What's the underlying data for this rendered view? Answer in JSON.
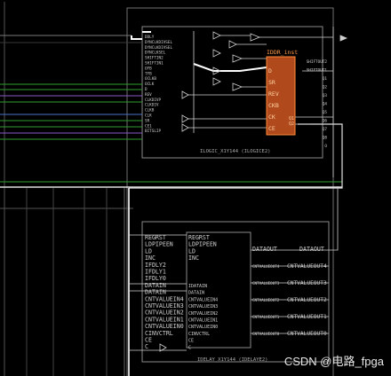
{
  "ilogic": {
    "title": "ILOGIC_X1Y144 (ILOGICE2)",
    "ports": [
      "DDLY",
      "DYNCLKDIVSEL",
      "DYNCLKDIVSEL",
      "DYNCLKSEL",
      "SHIFTIN2",
      "SHIFTIN1",
      "OFB",
      "TFB",
      "OCLKB",
      "OCLK",
      "D",
      "REV",
      "CLKDIVP",
      "CLKDIV",
      "CLKB",
      "CLK",
      "SR",
      "CE1",
      "BITSLIP"
    ],
    "right_ports": [
      "SHIFTOUT2",
      "SHIFTOUT1",
      "Q1",
      "Q2",
      "Q3",
      "Q4",
      "Q5",
      "Q6",
      "Q7",
      "Q8",
      "O"
    ]
  },
  "iddr": {
    "title": "IDDR_inst",
    "pins_left": [
      "D",
      "SR",
      "REV",
      "CKB",
      "CK",
      "CE"
    ],
    "pins_right": [
      "Q1",
      "Q2"
    ]
  },
  "idelay": {
    "title": "IDELAY_X1Y144 (IDELAYE2)",
    "outer_ports": [
      "REGRST",
      "LDPIPEEN",
      "LD",
      "INC",
      "IFDLY2",
      "IFDLY1",
      "IFDLY0",
      "DATAIN",
      "DATAIN",
      "CNTVALUEIN4",
      "CNTVALUEIN3",
      "CNTVALUEIN2",
      "CNTVALUEIN1",
      "CNTVALUEIN0",
      "CINVCTRL",
      "CE",
      "C"
    ],
    "inner_ports": [
      "REGRST",
      "LDPIPEEN",
      "LD",
      "INC",
      "IDATAIN",
      "DATAIN",
      "CNTVALUEIN4",
      "CNTVALUEIN3",
      "CNTVALUEIN2",
      "CNTVALUEIN1",
      "CNTVALUEIN0",
      "CINVCTRL",
      "CE",
      "C"
    ],
    "out_inner": [
      "DATAOUT",
      "CNTVALUEOUT4",
      "CNTVALUEOUT3",
      "CNTVALUEOUT2",
      "CNTVALUEOUT1",
      "CNTVALUEOUT0"
    ],
    "out_outer": [
      "DATAOUT",
      "CNTVALUEOUT4",
      "CNTVALUEOUT3",
      "CNTVALUEOUT2",
      "CNTVALUEOUT1",
      "CNTVALUEOUT0"
    ]
  },
  "watermark": "CSDN @电路_fpga",
  "colors": {
    "background": "#000000",
    "frame": "#8a8a8a",
    "wire": "#d0d0d0",
    "net_green": "#2f9b2f",
    "net_violet": "#8a57c9",
    "net_blue": "#4a72c9",
    "iddr_fill": "#b04a1d",
    "iddr_border": "#ff8a3a"
  }
}
